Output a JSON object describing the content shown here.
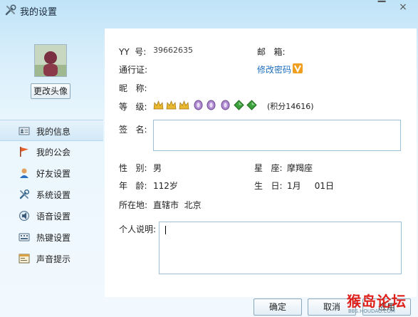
{
  "window": {
    "title": "我的设置",
    "close_glyph": "×",
    "min_glyph": "▔"
  },
  "sidebar": {
    "change_avatar_label": "更改头像",
    "items": [
      {
        "label": "我的信息",
        "icon": "id-card-icon",
        "active": true
      },
      {
        "label": "我的公会",
        "icon": "flag-icon",
        "active": false
      },
      {
        "label": "好友设置",
        "icon": "user-icon",
        "active": false
      },
      {
        "label": "系统设置",
        "icon": "tools-icon",
        "active": false
      },
      {
        "label": "语音设置",
        "icon": "voice-icon",
        "active": false
      },
      {
        "label": "热键设置",
        "icon": "keyboard-icon",
        "active": false
      },
      {
        "label": "声音提示",
        "icon": "sound-window-icon",
        "active": false
      }
    ]
  },
  "profile": {
    "yy_label": "YY  号:",
    "yy_value": "39662635",
    "mail_label": "邮   箱:",
    "mail_value": "",
    "passport_label": "通行证:",
    "passport_value": "",
    "change_password": "修改密码",
    "nickname_label": "昵   称:",
    "nickname_value": "",
    "level_label": "等   级:",
    "points_text": "(积分14616)",
    "signature_label": "签   名:",
    "gender_label": "性   别:",
    "gender_value": "男",
    "star_label": "星   座:",
    "star_value": "摩羯座",
    "age_label": "年   龄:",
    "age_value": "112岁",
    "birthday_label": "生   日:",
    "birthday_value": "1月     01日",
    "location_label": "所在地:",
    "location_value": "直辖市  北京",
    "desc_label": "个人说明:"
  },
  "buttons": {
    "ok": "确定",
    "cancel": "取消",
    "apply": "应用"
  },
  "watermark": {
    "text": "猴岛论坛",
    "sub": "BBS.HOUDAO.COM"
  },
  "colors": {
    "accent": "#1e6fbf",
    "gold": "#e0b020",
    "purple": "#9b6fc0",
    "green": "#3aa03a"
  }
}
